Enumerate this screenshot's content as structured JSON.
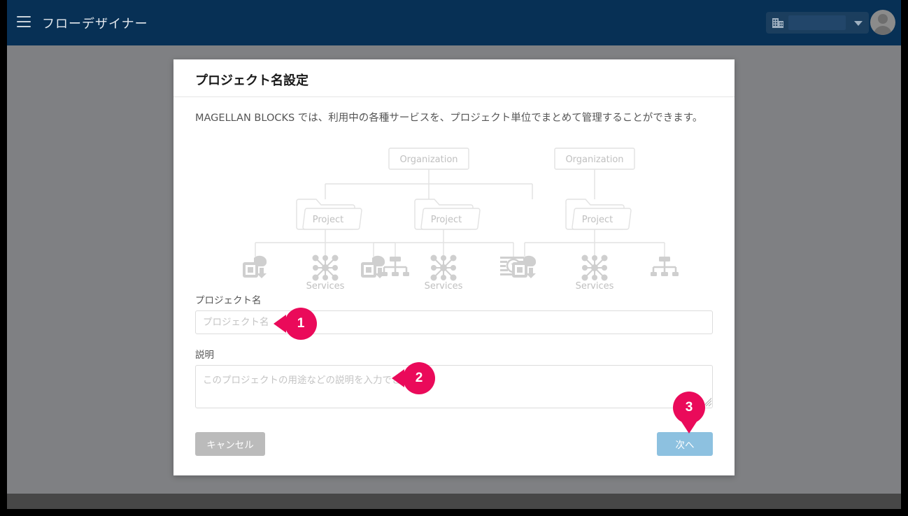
{
  "window": {
    "background_color": "#7f8083",
    "frame_color": "#000000",
    "footer_color": "#474747"
  },
  "header": {
    "title": "フローデザイナー",
    "background_color": "#073055",
    "menu_icon": "hamburger-icon",
    "org_selector": {
      "icon": "building-icon",
      "value": "",
      "caret_icon": "chevron-down-icon"
    },
    "avatar": {
      "icon": "user-avatar-icon"
    }
  },
  "dialog": {
    "title": "プロジェクト名設定",
    "description": "MAGELLAN BLOCKS では、利用中の各種サービスを、プロジェクト単位でまとめて管理することができます。",
    "diagram": {
      "organizations": [
        "Organization",
        "Organization"
      ],
      "projects": [
        "Project",
        "Project",
        "Project"
      ],
      "services_labels": [
        "Services",
        "Services",
        "Services"
      ],
      "service_icons": [
        [
          "cloud-chip-icon",
          "neural-network-icon",
          "flow-tree-icon"
        ],
        [
          "cloud-chip-icon",
          "neural-network-icon",
          "text-analysis-icon"
        ],
        [
          "cloud-chip-icon",
          "neural-network-icon",
          "flow-tree-icon"
        ]
      ],
      "line_color": "#e2e2e2",
      "text_color": "#c7c7c7"
    },
    "form": {
      "project_name": {
        "label": "プロジェクト名",
        "placeholder": "プロジェクト名",
        "value": ""
      },
      "description": {
        "label": "説明",
        "placeholder": "このプロジェクトの用途などの説明を入力できます。",
        "value": ""
      }
    },
    "buttons": {
      "cancel": {
        "label": "キャンセル",
        "color": "#bbbbbb"
      },
      "next": {
        "label": "次へ",
        "color": "#8dc1e0"
      }
    }
  },
  "annotations": {
    "color": "#ea0a5a",
    "markers": [
      {
        "number": "1",
        "target": "project-name-input"
      },
      {
        "number": "2",
        "target": "description-textarea"
      },
      {
        "number": "3",
        "target": "next-button"
      }
    ]
  }
}
